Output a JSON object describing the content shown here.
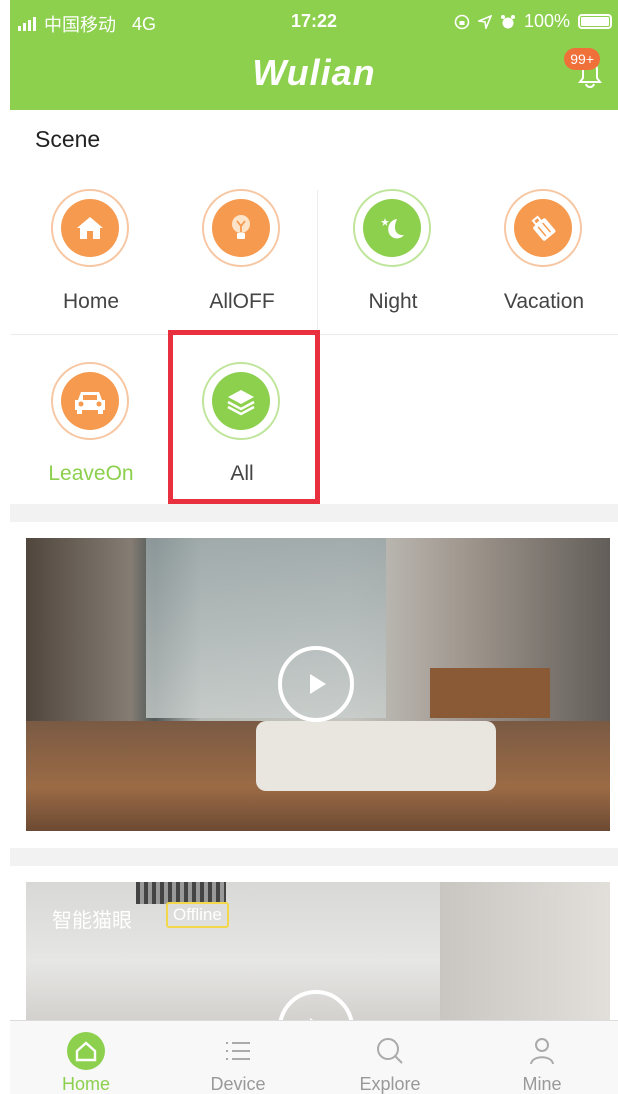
{
  "status_bar": {
    "carrier": "中国移动",
    "network": "4G",
    "time": "17:22",
    "battery": "100%"
  },
  "header": {
    "title": "Wulian",
    "notification_badge": "99+"
  },
  "scene": {
    "title": "Scene",
    "items": [
      {
        "label": "Home",
        "icon": "house-icon",
        "color": "orange"
      },
      {
        "label": "AllOFF",
        "icon": "bulb-icon",
        "color": "orange"
      },
      {
        "label": "Night",
        "icon": "moon-icon",
        "color": "green"
      },
      {
        "label": "Vacation",
        "icon": "luggage-icon",
        "color": "orange"
      },
      {
        "label": "LeaveOn",
        "icon": "car-icon",
        "color": "orange",
        "active": true
      },
      {
        "label": "All",
        "icon": "layers-icon",
        "color": "green",
        "highlighted": true
      }
    ]
  },
  "cameras": [
    {
      "name": "",
      "status": ""
    },
    {
      "name": "智能猫眼",
      "status": "Offline"
    }
  ],
  "tabbar": {
    "items": [
      {
        "label": "Home",
        "icon": "home-icon",
        "active": true
      },
      {
        "label": "Device",
        "icon": "list-icon"
      },
      {
        "label": "Explore",
        "icon": "search-icon"
      },
      {
        "label": "Mine",
        "icon": "person-icon"
      }
    ]
  },
  "colors": {
    "brand": "#8cd04e",
    "accent_orange": "#f59a4f",
    "highlight_red": "#e8303f",
    "offline_border": "#f2d74a"
  }
}
